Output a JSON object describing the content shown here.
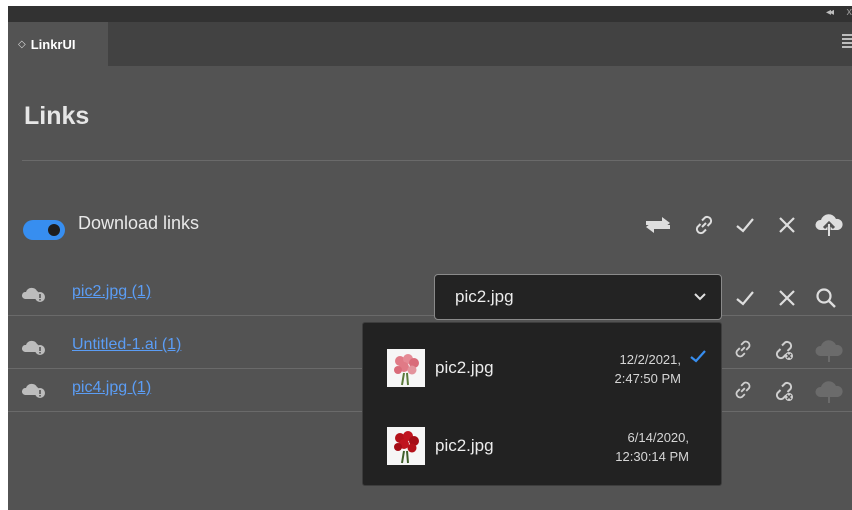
{
  "panel": {
    "tab_label": "LinkrUI",
    "tab_arrow": "◇",
    "collapse_glyph": "◂◂",
    "close_glyph": "x"
  },
  "page": {
    "title": "Links"
  },
  "download": {
    "label": "Download links",
    "toggle_on": true
  },
  "toolbar_icons": [
    "swap-icon",
    "link-icon",
    "check-icon",
    "close-icon",
    "cloud-upload-icon"
  ],
  "rows": [
    {
      "file": "pic2.jpg (1)",
      "icon": "cloud-alert-icon"
    },
    {
      "file": "Untitled-1.ai (1)",
      "icon": "cloud-alert-icon"
    },
    {
      "file": "pic4.jpg (1)",
      "icon": "cloud-alert-icon"
    }
  ],
  "row1_actions": [
    "check-icon",
    "close-icon",
    "search-icon"
  ],
  "row_actions": [
    "link-icon",
    "unlink-icon",
    "cloud-upload-icon"
  ],
  "select": {
    "value": "pic2.jpg"
  },
  "dropdown": {
    "items": [
      {
        "name": "pic2.jpg",
        "date": "12/2/2021,",
        "time": "2:47:50 PM",
        "selected": true,
        "thumb": "pink-roses"
      },
      {
        "name": "pic2.jpg",
        "date": "6/14/2020,",
        "time": "12:30:14 PM",
        "selected": false,
        "thumb": "red-roses"
      }
    ]
  },
  "colors": {
    "panel_bg": "#535353",
    "accent": "#378ef0",
    "link": "#5b9df5",
    "dropdown_bg": "#222222"
  }
}
